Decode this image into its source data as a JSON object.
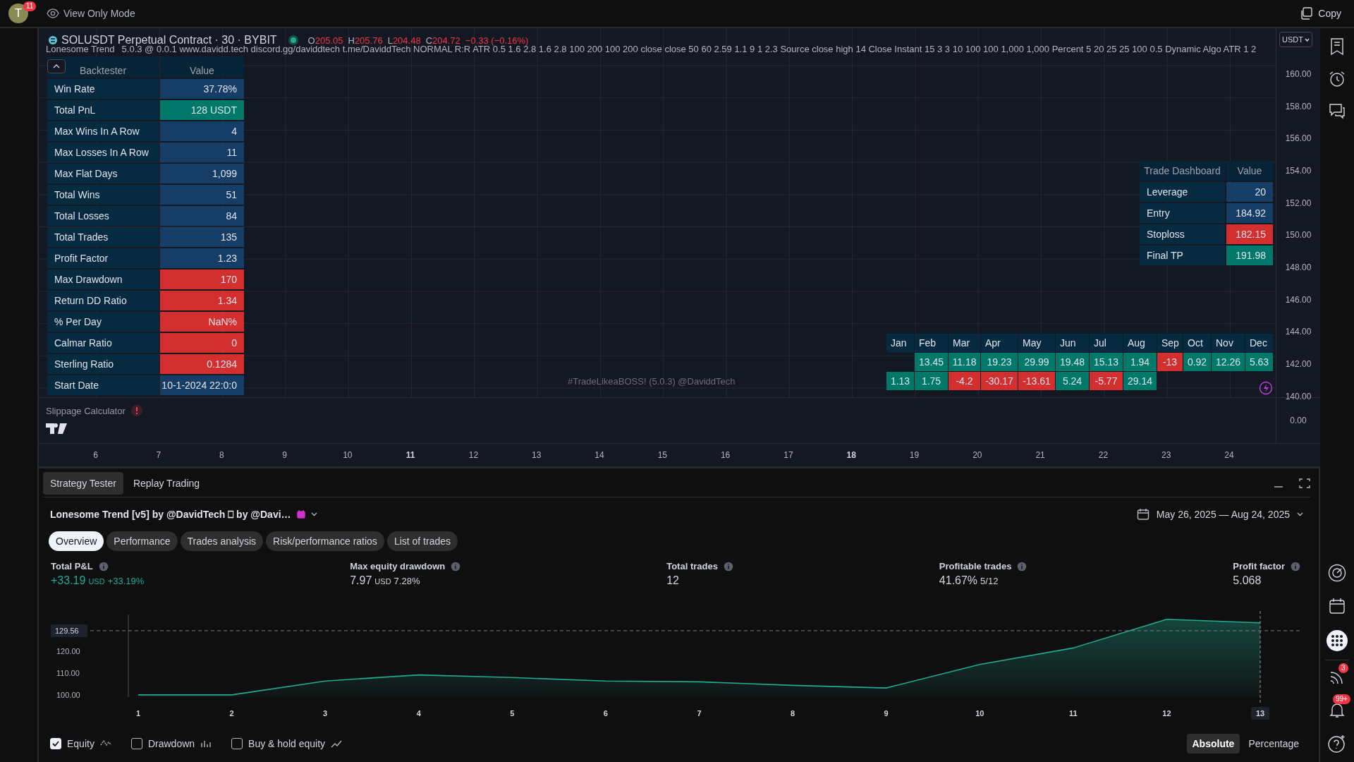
{
  "top_bar": {
    "avatar": "T",
    "avatar_badge": "11",
    "mode": "View Only Mode",
    "copy": "Copy"
  },
  "chart": {
    "symbol": "SOLUSDT Perpetual Contract · 30 · BYBIT",
    "ohlc": [
      {
        "label": "O",
        "value": "205.05"
      },
      {
        "label": "H",
        "value": "205.76"
      },
      {
        "label": "L",
        "value": "204.48"
      },
      {
        "label": "C",
        "value": "204.72"
      }
    ],
    "change": "−0.33 (−0.16%)",
    "currency": "USDT",
    "indicator_name": "Lonesome Trend",
    "indicator_params": "5.0.3 @ 0.0.1 www.davidd.tech discord.gg/daviddtech t.me/DaviddTech NORMAL R:R ATR 0.5 1.6 2.8 1.6 2.8 100 200 100 200 close close 50 60 2.59 1.1 9 1 2.3 Source close high 14 Close Instant 15 3 3 10 100 100 1,000 1,000 Percent 5 20 25 25 100 0.5 Dynamic Algo ATR 1 2",
    "backtester": {
      "columns": [
        "Backtester",
        "Value"
      ],
      "rows": [
        {
          "label": "Win Rate",
          "value": "37.78%",
          "color": "#163d66"
        },
        {
          "label": "Total PnL",
          "value": "128 USDT",
          "color": "#00796b"
        },
        {
          "label": "Max Wins In A Row",
          "value": "4",
          "color": "#163d66"
        },
        {
          "label": "Max Losses In A Row",
          "value": "11",
          "color": "#163d66"
        },
        {
          "label": "Max Flat Days",
          "value": "1,099",
          "color": "#163d66"
        },
        {
          "label": "Total Wins",
          "value": "51",
          "color": "#163d66"
        },
        {
          "label": "Total Losses",
          "value": "84",
          "color": "#163d66"
        },
        {
          "label": "Total Trades",
          "value": "135",
          "color": "#163d66"
        },
        {
          "label": "Profit Factor",
          "value": "1.23",
          "color": "#163d66"
        },
        {
          "label": "Max Drawdown",
          "value": "170",
          "color": "#d32f2f"
        },
        {
          "label": "Return DD Ratio",
          "value": "1.34",
          "color": "#d32f2f"
        },
        {
          "label": "% Per Day",
          "value": "NaN%",
          "color": "#d32f2f"
        },
        {
          "label": "Calmar Ratio",
          "value": "0",
          "color": "#d32f2f"
        },
        {
          "label": "Sterling Ratio",
          "value": "0.1284",
          "color": "#d32f2f"
        },
        {
          "label": "Start Date",
          "value": "10-1-2024 22:0:0",
          "color": "#163d66"
        }
      ]
    },
    "signature": "#TradeLikeaBOSS! (5.0.3) @DaviddTech",
    "trade_dashboard": {
      "columns": [
        "Trade Dashboard",
        "Value"
      ],
      "rows": [
        {
          "label": "Leverage",
          "value": "20",
          "color": "#163d66"
        },
        {
          "label": "Entry",
          "value": "184.92",
          "color": "#163d66"
        },
        {
          "label": "Stoploss",
          "value": "182.15",
          "color": "#d32f2f"
        },
        {
          "label": "Final TP",
          "value": "191.98",
          "color": "#00796b"
        }
      ]
    },
    "monthly": {
      "months": [
        "Jan",
        "Feb",
        "Mar",
        "Apr",
        "May",
        "Jun",
        "Jul",
        "Aug",
        "Sep",
        "Oct",
        "Nov",
        "Dec"
      ],
      "rows": [
        {
          "cells": [
            {},
            {
              "value": "13.45",
              "color": "#00796b"
            },
            {
              "value": "11.18",
              "color": "#00796b"
            },
            {
              "value": "19.23",
              "color": "#00796b"
            },
            {
              "value": "29.99",
              "color": "#00796b"
            },
            {
              "value": "19.48",
              "color": "#00796b"
            },
            {
              "value": "15.13",
              "color": "#00796b"
            },
            {
              "value": "1.94",
              "color": "#00796b"
            },
            {
              "value": "-13",
              "color": "#d32f2f"
            },
            {
              "value": "0.92",
              "color": "#00796b"
            },
            {
              "value": "12.26",
              "color": "#00796b"
            },
            {
              "value": "5.63",
              "color": "#00796b"
            }
          ]
        },
        {
          "cells": [
            {
              "value": "1.13",
              "color": "#00796b"
            },
            {
              "value": "1.75",
              "color": "#00796b"
            },
            {
              "value": "-4.2",
              "color": "#d32f2f"
            },
            {
              "value": "-30.17",
              "color": "#d32f2f"
            },
            {
              "value": "-13.61",
              "color": "#d32f2f"
            },
            {
              "value": "5.24",
              "color": "#00796b"
            },
            {
              "value": "-5.77",
              "color": "#d32f2f"
            },
            {
              "value": "29.14",
              "color": "#00796b"
            }
          ]
        }
      ]
    },
    "price_axis": [
      "160.00",
      "158.00",
      "156.00",
      "154.00",
      "152.00",
      "150.00",
      "148.00",
      "146.00",
      "144.00",
      "142.00",
      "140.00"
    ],
    "slippage_label": "Slippage Calculator",
    "slippage_axis": "0.00",
    "time_axis": [
      {
        "label": "6",
        "bold": false
      },
      {
        "label": "7",
        "bold": false
      },
      {
        "label": "8",
        "bold": false
      },
      {
        "label": "9",
        "bold": false
      },
      {
        "label": "10",
        "bold": false
      },
      {
        "label": "11",
        "bold": true
      },
      {
        "label": "12",
        "bold": false
      },
      {
        "label": "13",
        "bold": false
      },
      {
        "label": "14",
        "bold": false
      },
      {
        "label": "15",
        "bold": false
      },
      {
        "label": "16",
        "bold": false
      },
      {
        "label": "17",
        "bold": false
      },
      {
        "label": "18",
        "bold": true
      },
      {
        "label": "19",
        "bold": false
      },
      {
        "label": "20",
        "bold": false
      },
      {
        "label": "21",
        "bold": false
      },
      {
        "label": "22",
        "bold": false
      },
      {
        "label": "23",
        "bold": false
      },
      {
        "label": "24",
        "bold": false
      }
    ]
  },
  "strategy_tester": {
    "tabs": [
      {
        "label": "Strategy Tester",
        "selected": true
      },
      {
        "label": "Replay Trading",
        "selected": false
      }
    ],
    "title": "Lonesome Trend [v5] by @DavidTech ⎕ by @Davi…",
    "date_range": "May 26, 2025 — Aug 24, 2025",
    "subtabs": [
      {
        "label": "Overview",
        "selected": true
      },
      {
        "label": "Performance",
        "selected": false
      },
      {
        "label": "Trades analysis",
        "selected": false
      },
      {
        "label": "Risk/performance ratios",
        "selected": false
      },
      {
        "label": "List of trades",
        "selected": false
      }
    ],
    "metrics": [
      {
        "label": "Total P&L",
        "value": "+33.19",
        "unit": "USD",
        "extra": "+33.19%",
        "positive": true
      },
      {
        "label": "Max equity drawdown",
        "value": "7.97",
        "unit": "USD",
        "extra": "7.28%",
        "positive": false
      },
      {
        "label": "Total trades",
        "value": "12",
        "positive": false
      },
      {
        "label": "Profitable trades",
        "value": "41.67%",
        "extra": "5/12",
        "positive": false
      },
      {
        "label": "Profit factor",
        "value": "5.068",
        "positive": false
      }
    ],
    "chart_data": {
      "type": "area",
      "x": [
        1,
        2,
        3,
        4,
        5,
        6,
        7,
        8,
        9,
        10,
        11,
        12,
        13
      ],
      "series": [
        {
          "name": "Equity",
          "color": "#22ab94",
          "values": [
            100,
            100,
            106.4,
            109.2,
            108,
            106.4,
            106,
            104.4,
            103.2,
            114,
            121.6,
            134.8,
            133.2
          ]
        }
      ],
      "xlim": [
        1,
        13
      ],
      "ylim": [
        99,
        137
      ],
      "xticks": [
        1,
        2,
        3,
        4,
        5,
        6,
        7,
        8,
        9,
        10,
        11,
        12,
        13
      ],
      "yticks": [
        {
          "value": 100,
          "label": "100.00"
        },
        {
          "value": 110,
          "label": "110.00"
        },
        {
          "value": 120,
          "label": "120.00"
        },
        {
          "value": 129.56,
          "label": "129.56"
        }
      ]
    },
    "legend": [
      {
        "checked": true,
        "kind": "equity"
      },
      {
        "label": "Drawdown",
        "checked": false,
        "kind": "drawdown"
      },
      {
        "label": "Buy & hold equity",
        "checked": false,
        "kind": "buyhold"
      }
    ],
    "scale_modes": [
      {
        "label": "Absolute",
        "selected": true
      },
      {
        "label": "Percentage",
        "selected": false
      }
    ]
  },
  "sidebar": {
    "feed_badge": "3",
    "alerts_badge": "99+"
  }
}
